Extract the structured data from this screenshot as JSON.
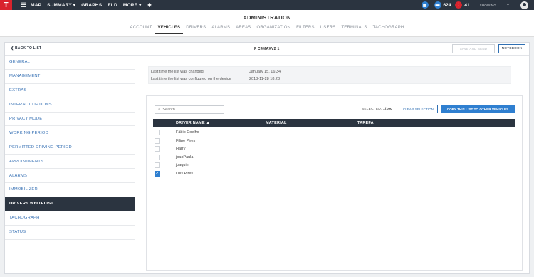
{
  "topbar": {
    "logo_text": "T",
    "menu_icon": "hamburger-icon",
    "nav": [
      "MAP",
      "SUMMARY ▾",
      "GRAPHS",
      "ELD",
      "MORE ▾"
    ],
    "settings_icon": "gear-icon",
    "notifications": {
      "icon": "calendar-icon",
      "chat_icon": "chat-icon",
      "chat_count": "624",
      "alert_icon": "alert-icon",
      "alert_count": "41",
      "accent_blue": "#2f7fd0",
      "accent_red": "#d9232d"
    },
    "showing_label": "SHOWING",
    "user_icon": "user-avatar-icon"
  },
  "admin": {
    "title": "ADMINISTRATION",
    "tabs": [
      "ACCOUNT",
      "VEHICLES",
      "DRIVERS",
      "ALARMS",
      "AREAS",
      "ORGANIZATION",
      "FILTERS",
      "USERS",
      "TERMINALS",
      "TACHOGRAPH"
    ],
    "active_tab": "VEHICLES"
  },
  "card": {
    "back_label": "BACK TO LIST",
    "vehicle_name": "F C4MAXV2 1",
    "save_label": "SAVE AND SEND",
    "notebook_label": "NOTEBOOK"
  },
  "sidebar": {
    "items": [
      {
        "label": "GENERAL"
      },
      {
        "label": "MANAGEMENT"
      },
      {
        "label": "EXTRAS"
      },
      {
        "label": "INTERACT OPTIONS"
      },
      {
        "label": "PRIVACY MODE"
      },
      {
        "label": "WORKING PERIOD"
      },
      {
        "label": "PERMITTED DRIVING PERIOD"
      },
      {
        "label": "APPOINTMENTS"
      },
      {
        "label": "ALARMS"
      },
      {
        "label": "IMMOBILIZER"
      },
      {
        "label": "DRIVERS WHITELIST"
      },
      {
        "label": "TACHOGRAPH"
      },
      {
        "label": "STATUS"
      }
    ],
    "active": "DRIVERS WHITELIST"
  },
  "info": {
    "changed_label": "Last time the list was changed",
    "changed_value": "January 15, 16:34",
    "configured_label": "Last time the list was configured on the device",
    "configured_value": "2018-11-28 18:23"
  },
  "list": {
    "search_placeholder": "Search",
    "selected_label": "SELECTED:",
    "selected_value": "1/100",
    "clear_label": "CLEAR SELECTION",
    "copy_label": "COPY THIS LIST TO OTHER VEHICLES",
    "columns": [
      "DRIVER NAME ▲",
      "MATERIAL",
      "TAREFA"
    ],
    "rows": [
      {
        "name": "Fábio Coelho",
        "checked": false
      },
      {
        "name": "Filipe Pires",
        "checked": false
      },
      {
        "name": "Harry",
        "checked": false
      },
      {
        "name": "joaoPaula",
        "checked": false
      },
      {
        "name": "joaquim",
        "checked": false
      },
      {
        "name": "Luis Pires",
        "checked": true
      }
    ]
  }
}
